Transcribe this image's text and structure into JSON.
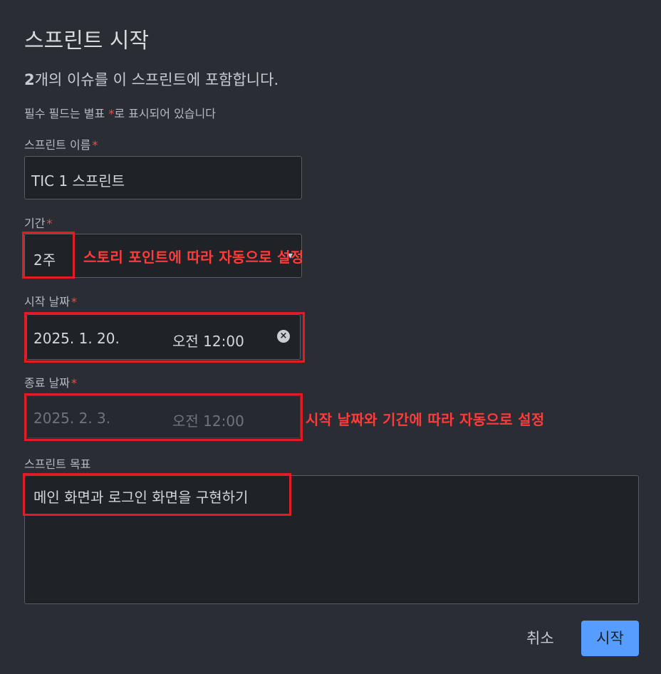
{
  "dialog": {
    "title": "스프린트 시작",
    "summary_count": "2",
    "summary_rest": "개의 이슈를 이 스프린트에 포함합니다.",
    "required_note_pre": "필수 필드는 별표 ",
    "required_star": "*",
    "required_note_post": "로 표시되어 있습니다"
  },
  "fields": {
    "name": {
      "label": "스프린트 이름",
      "value": "TIC 1 스프린트"
    },
    "duration": {
      "label": "기간",
      "value": "2주"
    },
    "start_date": {
      "label": "시작 날짜",
      "date": "2025. 1. 20.",
      "time": "오전 12:00"
    },
    "end_date": {
      "label": "종료 날짜",
      "date": "2025. 2. 3.",
      "time": "오전 12:00"
    },
    "goal": {
      "label": "스프린트 목표",
      "value": "메인 화면과 로그인 화면을 구현하기"
    },
    "required_star": "*"
  },
  "annotations": {
    "duration_note": "스토리 포인트에 따라 자동으로 설정",
    "end_date_note": "시작 날짜와 기간에 따라 자동으로 설정"
  },
  "buttons": {
    "cancel": "취소",
    "start": "시작"
  },
  "colors": {
    "background": "#2a2d33",
    "annotation_red": "#e11c24",
    "primary_button": "#579dff",
    "required_star": "#e5534b"
  }
}
